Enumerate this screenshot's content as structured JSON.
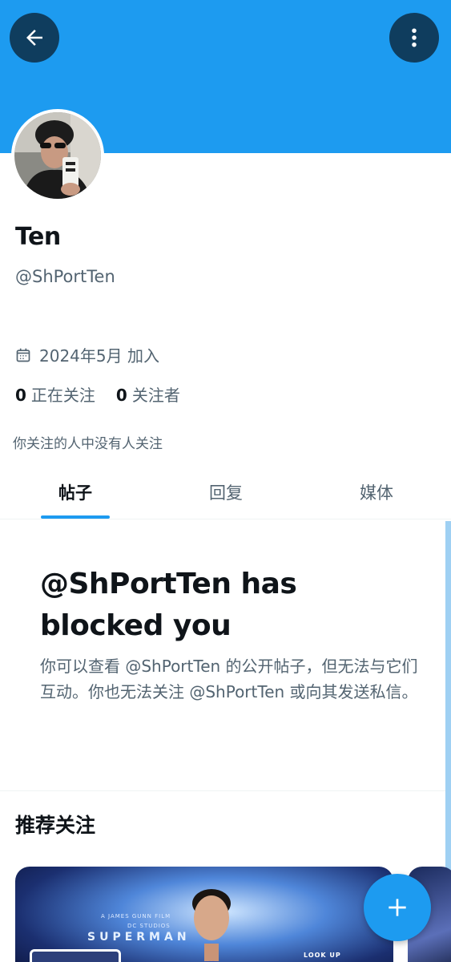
{
  "header": {
    "back_icon": "arrow-left-icon",
    "more_icon": "more-vertical-icon",
    "banner_color": "#1d9bf0"
  },
  "profile": {
    "name": "Ten",
    "handle": "@ShPortTen",
    "joined": "2024年5月 加入",
    "following_count": "0",
    "following_label": "正在关注",
    "followers_count": "0",
    "followers_label": "关注者",
    "followed_by_note": "你关注的人中没有人关注"
  },
  "tabs": [
    {
      "label": "帖子",
      "active": true
    },
    {
      "label": "回复",
      "active": false
    },
    {
      "label": "媒体",
      "active": false
    }
  ],
  "blocked": {
    "title": "@ShPortTen has blocked you",
    "description": "你可以查看 @ShPortTen 的公开帖子，但无法与它们互动。你也无法关注 @ShPortTen 或向其发送私信。"
  },
  "recommended": {
    "title": "推荐关注",
    "card": {
      "tag": "SUPERMAN",
      "small_text": "A JAMES GUNN FILM",
      "studio_text": "DC STUDIOS",
      "corner_text": "LOOK UP"
    }
  },
  "fab": {
    "icon": "plus-icon"
  },
  "colors": {
    "accent": "#1d9bf0",
    "text_primary": "#0f1419",
    "text_secondary": "#536471"
  }
}
